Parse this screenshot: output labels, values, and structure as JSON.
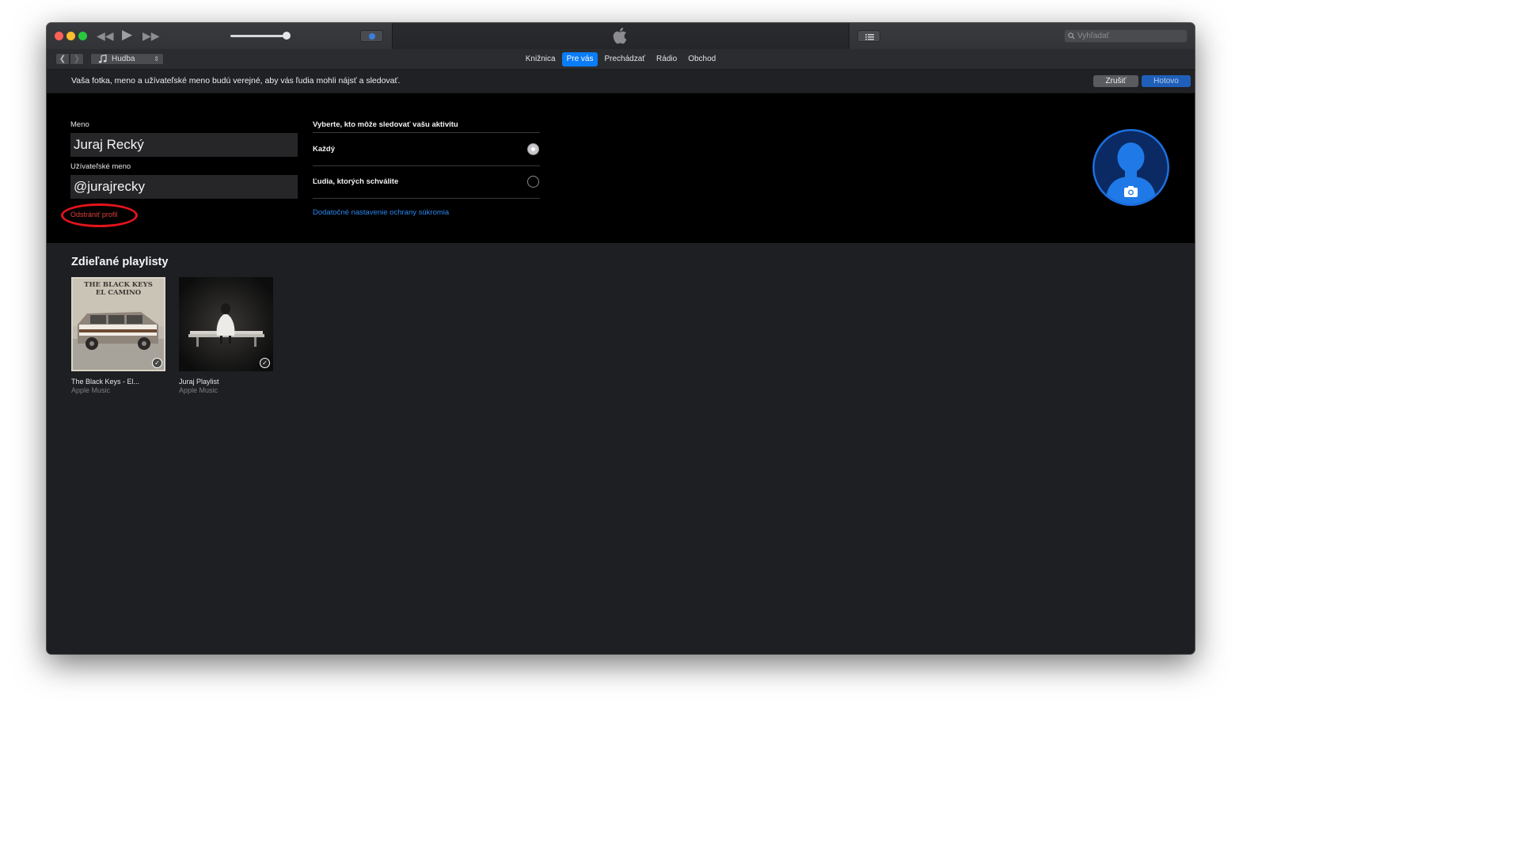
{
  "window": {
    "search_placeholder": "Vyhľadať"
  },
  "toolbar": {
    "media_kind": "Hudba",
    "tabs": [
      {
        "label": "Knižnica",
        "active": false
      },
      {
        "label": "Pre vás",
        "active": true
      },
      {
        "label": "Prechádzať",
        "active": false
      },
      {
        "label": "Rádio",
        "active": false
      },
      {
        "label": "Obchod",
        "active": false
      }
    ]
  },
  "notice": {
    "text": "Vaša fotka, meno a užívateľské meno budú verejné, aby vás ľudia mohli nájsť a sledovať.",
    "cancel_label": "Zrušiť",
    "done_label": "Hotovo"
  },
  "profile": {
    "name_label": "Meno",
    "name_value": "Juraj Recký",
    "username_label": "Užívateľské meno",
    "username_value": "@jurajrecky",
    "remove_label": "Odstrániť profil",
    "privacy_title": "Vyberte, kto môže sledovať vašu aktivitu",
    "privacy_options": [
      {
        "label": "Každý",
        "selected": true
      },
      {
        "label": "Ľudia, ktorých schválite",
        "selected": false
      }
    ],
    "privacy_link": "Dodatočné nastavenie ochrany súkromia"
  },
  "shared": {
    "title": "Zdieľané playlisty",
    "playlists": [
      {
        "title": "The Black Keys - El...",
        "subtitle": "Apple Music",
        "cover_text_1": "THE BLACK KEYS",
        "cover_text_2": "EL CAMINO",
        "checked": true
      },
      {
        "title": "Juraj Playlist",
        "subtitle": "Apple Music",
        "checked": true
      }
    ]
  },
  "colors": {
    "accent": "#0a7cf5",
    "link": "#2a86f0",
    "danger": "#e0413a",
    "annotation": "#e3141c",
    "avatar_ring": "#1c6fe0"
  },
  "icons": [
    "close-icon",
    "minimize-icon",
    "maximize-icon",
    "rewind-icon",
    "play-icon",
    "fast-forward-icon",
    "volume-slider",
    "airplay-icon",
    "apple-logo-icon",
    "list-icon",
    "search-icon",
    "chevron-left-icon",
    "chevron-right-icon",
    "music-note-icon",
    "camera-icon",
    "checkmark-icon"
  ]
}
